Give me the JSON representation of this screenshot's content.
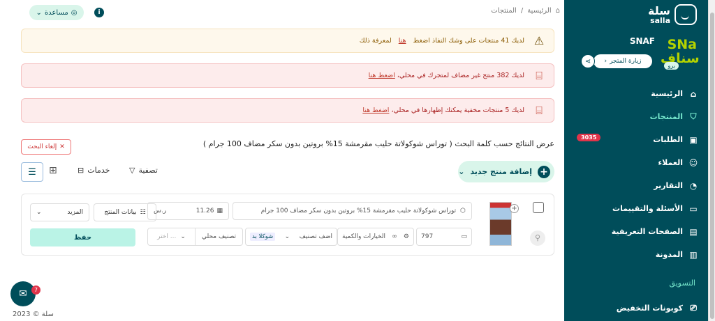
{
  "header": {
    "help_label": "مساعدة",
    "breadcrumb": {
      "home": "الرئيسية",
      "separator": "/",
      "current": "المنتجات"
    }
  },
  "alerts": [
    {
      "text": "لديك 41 منتجات على وشك النفاذ اضغط",
      "link": "هنا",
      "suffix": "لمعرفة ذلك",
      "icon": "warning-icon"
    },
    {
      "text": "لديك 382 منتج غير مضاف لمتجرك في محلي،",
      "link": "اضغط هنا",
      "icon": "store-icon"
    },
    {
      "text": "لديك 5 منتجات مخفية يمكنك إظهارها في محلي،",
      "link": "اضغط هنا",
      "icon": "store-icon"
    }
  ],
  "search": {
    "title": "عرض النتائج حسب كلمة البحث ( توراس شوكولاتة حليب مقرمشة 15% بروتين بدون سكر مضاف 100 جرام )",
    "cancel_label": "إلغاء البحث"
  },
  "toolbar": {
    "add_product": "إضافة منتج جديد",
    "filter": "تصفية",
    "services": "خدمات"
  },
  "product": {
    "name": "توراس شوكولاتة حليب مقرمشة 15% بروتين بدون سكر مضاف 100 جرام",
    "price": "11.26",
    "currency": "ر.س",
    "quantity": "797",
    "options_label": "الخيارات والكمية",
    "category_tag": "شوكلا بد",
    "add_category": "اضف تصنيف",
    "local_category": "تصنيف محلي",
    "local_placeholder": "اختر ...",
    "product_data": "بيانات المنتج",
    "more": "المزيد",
    "save": "حفظ"
  },
  "sidebar": {
    "logo_ar": "سلة",
    "logo_en": "salla",
    "store_name": "SNAF",
    "store_logo_lines": [
      "SNa",
      "سناف"
    ],
    "pro_badge": "برو",
    "visit_store": "زيارة المتجر",
    "items": [
      {
        "label": "الرئيسية",
        "icon": "home-icon",
        "active": false
      },
      {
        "label": "المنتجات",
        "icon": "shirt-icon",
        "active": true
      },
      {
        "label": "الطلبات",
        "icon": "box-icon",
        "active": false,
        "badge": "3035"
      },
      {
        "label": "العملاء",
        "icon": "users-icon",
        "active": false
      },
      {
        "label": "التقارير",
        "icon": "chart-icon",
        "active": false
      },
      {
        "label": "الأسئلة والتقييمات",
        "icon": "message-icon",
        "active": false
      },
      {
        "label": "الصفحات التعريفية",
        "icon": "page-icon",
        "active": false
      },
      {
        "label": "المدونة",
        "icon": "book-icon",
        "active": false
      }
    ],
    "section_marketing": "التسويق",
    "coupons": "كوبونات التخفيض"
  },
  "chat": {
    "badge": "7"
  },
  "footer": {
    "copyright": "سلة © 2023"
  },
  "colors": {
    "primary": "#004d5a",
    "accent": "#76e8cd",
    "danger": "#e0344a",
    "light": "#d9f5ea"
  }
}
